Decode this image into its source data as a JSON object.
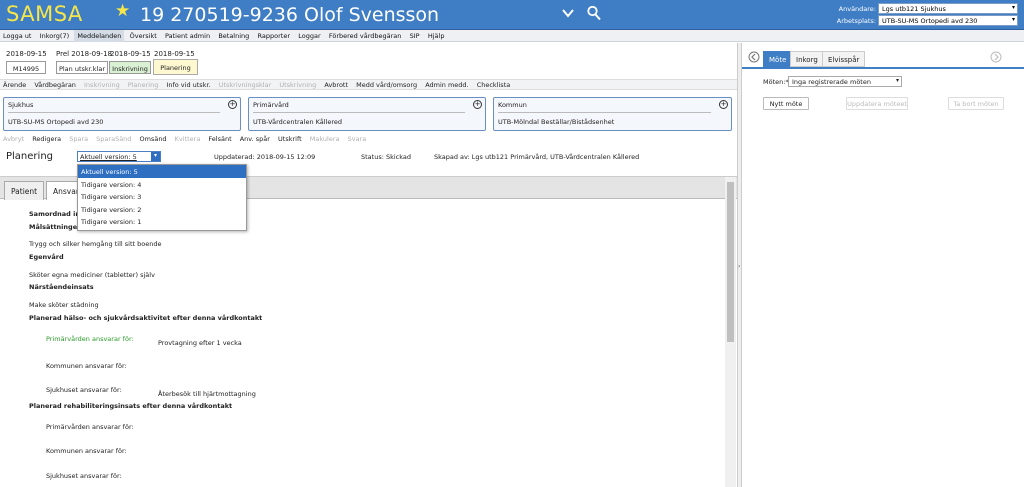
{
  "header": {
    "logo": "SAMSA",
    "patient_title": "19 270519-9236 Olof Svensson",
    "user_label": "Användare:",
    "user_value": "Lgs utb121 Sjukhus",
    "workplace_label": "Arbetsplats:",
    "workplace_value": "UTB-SU-MS Ortopedi avd 230",
    "brand_color": "#3f7ec4"
  },
  "menu": [
    "Logga ut",
    "Inkorg(7)",
    "Meddelanden",
    "Översikt",
    "Patient admin",
    "Betalning",
    "Rapporter",
    "Loggar",
    "Förbered vårdbegäran",
    "SIP",
    "Hjälp"
  ],
  "timeline": {
    "date1": "2018-09-15",
    "id1": "M14995",
    "prel_label": "Prel 2018-09-18",
    "plan_ready": "Plan utskr.klar",
    "date2": "2018-09-15",
    "inskrivning": "Inskrivning",
    "date3": "2018-09-15",
    "planering": "Planering"
  },
  "row1": [
    "Ärende",
    "Vårdbegäran",
    "Inskrivning",
    "Planering",
    "Info vid utskr.",
    "Utskrivningsklar",
    "Utskrivning",
    "Avbrott",
    "Medd vård/omsorg",
    "Admin medd.",
    "Checklista"
  ],
  "cards": [
    {
      "title": "Sjukhus",
      "value": "UTB-SU-MS Ortopedi avd 230"
    },
    {
      "title": "Primärvård",
      "value": "UTB-Vårdcentralen Kållered"
    },
    {
      "title": "Kommun",
      "value": "UTB-Mölndal Beställar/Bistådsenhet"
    }
  ],
  "row2": [
    "Avbryt",
    "Redigera",
    "Spara",
    "SparaSänd",
    "Omsänd",
    "Kvittera",
    "Felsänt",
    "Anv. spår",
    "Utskrift",
    "Makulera",
    "Svara"
  ],
  "plan": {
    "title": "Planering",
    "version_selected": "Aktuell version: 5",
    "updated": "Uppdaterad: 2018-09-15 12:09",
    "status": "Status: Skickad",
    "created_by": "Skapad av: Lgs utb121 Primärvård, UTB-Vårdcentralen Kållered",
    "versions": [
      "Aktuell version: 5",
      "Tidigare version: 4",
      "Tidigare version: 3",
      "Tidigare version: 2",
      "Tidigare version: 1"
    ]
  },
  "tabs": {
    "patient": "Patient",
    "ansvar": "Ansvar"
  },
  "content": {
    "samordnad": "Samordnad in",
    "malsattning": "Målsättningen",
    "trygg": "Trygg och silker hemgång till sitt boende",
    "egenvard": "Egenvård",
    "skoter": "Sköter egna mediciner (tabletter) själv",
    "narstaende": "Närståendeinsats",
    "make": "Make sköter städning",
    "planerad_halso": "Planerad hälso- och sjukvårdsaktivitet efter denna vårdkontakt",
    "prim_ansvar": "Primärvården ansvarar för:",
    "prim_value": "Provtagning efter 1 vecka",
    "kommun_ansvar": "Kommunen ansvarar för:",
    "sjukhus_ansvar": "Sjukhuset ansvarar för:",
    "sjukhus_value": "Återbesök till hjärtmottagning",
    "planerad_rehab": "Planerad rehabiliteringsinsats efter denna vårdkontakt",
    "prim_ansvar2": "Primärvården ansvarar för:",
    "kommun_ansvar2": "Kommunen ansvarar för:",
    "sjukhus_ansvar2": "Sjukhuset ansvarar för:"
  },
  "right": {
    "tabs": [
      "Möte",
      "Inkorg",
      "Elvisspår"
    ],
    "meetings_label": "Möten:*",
    "meetings_value": "Inga registrerade möten",
    "new_meeting": "Nytt möte",
    "update_meeting": "Uppdatera möteet",
    "delete_meeting": "Ta bort möten"
  }
}
